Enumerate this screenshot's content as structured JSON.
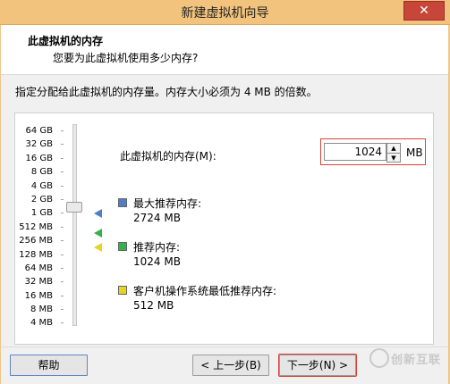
{
  "window": {
    "title": "新建虚拟机向导",
    "close_icon": "close-icon"
  },
  "header": {
    "title": "此虚拟机的内存",
    "subtitle": "您要为此虚拟机使用多少内存?"
  },
  "description": "指定分配给此虚拟机的内存量。内存大小必须为 4 MB 的倍数。",
  "memory": {
    "label": "此虚拟机的内存(M):",
    "value": "1024",
    "unit": "MB",
    "scale_labels": [
      "64 GB",
      "32 GB",
      "16 GB",
      "8 GB",
      "4 GB",
      "2 GB",
      "1 GB",
      "512 MB",
      "256 MB",
      "128 MB",
      "64 MB",
      "32 MB",
      "16 MB",
      "8 MB",
      "4 MB"
    ],
    "selected": "1 GB"
  },
  "legend": {
    "max": {
      "label": "最大推荐内存:",
      "value": "2724 MB",
      "color": "#4e7fc6"
    },
    "recommended": {
      "label": "推荐内存:",
      "value": "1024 MB",
      "color": "#33b14b"
    },
    "min": {
      "label": "客户机操作系统最低推荐内存:",
      "value": "512 MB",
      "color": "#e6d51f"
    }
  },
  "footer": {
    "help": "帮助",
    "back": "< 上一步(B)",
    "next": "下一步(N) >"
  },
  "watermark": "创新互联"
}
